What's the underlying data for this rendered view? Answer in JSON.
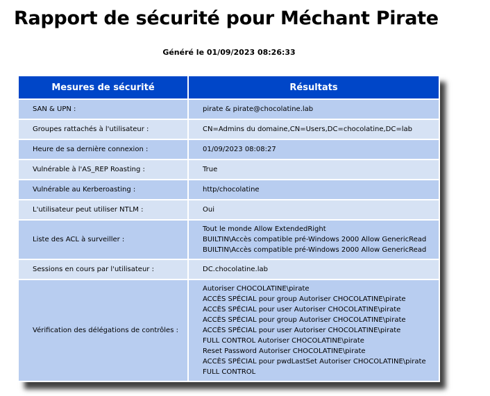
{
  "report": {
    "title": "Rapport de sécurité pour Méchant Pirate",
    "generated": "Généré le 01/09/2023 08:26:33",
    "headers": {
      "measures": "Mesures de sécurité",
      "results": "Résultats"
    },
    "rows": [
      {
        "label": "SAN & UPN :",
        "lines": [
          "pirate & pirate@chocolatine.lab"
        ]
      },
      {
        "label": "Groupes rattachés à l'utilisateur :",
        "lines": [
          "CN=Admins du domaine,CN=Users,DC=chocolatine,DC=lab"
        ]
      },
      {
        "label": "Heure de sa dernière connexion :",
        "lines": [
          "01/09/2023 08:08:27"
        ]
      },
      {
        "label": "Vulnérable à l'AS_REP Roasting :",
        "lines": [
          "True"
        ]
      },
      {
        "label": "Vulnérable au Kerberoasting :",
        "lines": [
          "http/chocolatine"
        ]
      },
      {
        "label": "L'utilisateur peut utiliser NTLM :",
        "lines": [
          "Oui"
        ]
      },
      {
        "label": "Liste des ACL à surveiller :",
        "lines": [
          "Tout le monde Allow ExtendedRight",
          "BUILTIN\\Accès compatible pré-Windows 2000 Allow GenericRead",
          "BUILTIN\\Accès compatible pré-Windows 2000 Allow GenericRead"
        ]
      },
      {
        "label": "Sessions en cours par l'utilisateur :",
        "lines": [
          "DC.chocolatine.lab"
        ]
      },
      {
        "label": "Vérification des délégations de contrôles :",
        "lines": [
          "Autoriser CHOCOLATINE\\pirate",
          "ACCÈS SPÉCIAL pour group Autoriser CHOCOLATINE\\pirate",
          "ACCÈS SPÉCIAL pour user Autoriser CHOCOLATINE\\pirate",
          "ACCÈS SPÉCIAL pour group Autoriser CHOCOLATINE\\pirate",
          "ACCÈS SPÉCIAL pour user Autoriser CHOCOLATINE\\pirate",
          "FULL CONTROL Autoriser CHOCOLATINE\\pirate",
          "Reset Password Autoriser CHOCOLATINE\\pirate",
          "ACCÈS SPÉCIAL pour pwdLastSet Autoriser CHOCOLATINE\\pirate",
          "FULL CONTROL"
        ]
      }
    ]
  },
  "colors": {
    "header_bg": "#0046c8",
    "row_odd": "#b8cdf0",
    "row_even": "#d6e2f4"
  }
}
